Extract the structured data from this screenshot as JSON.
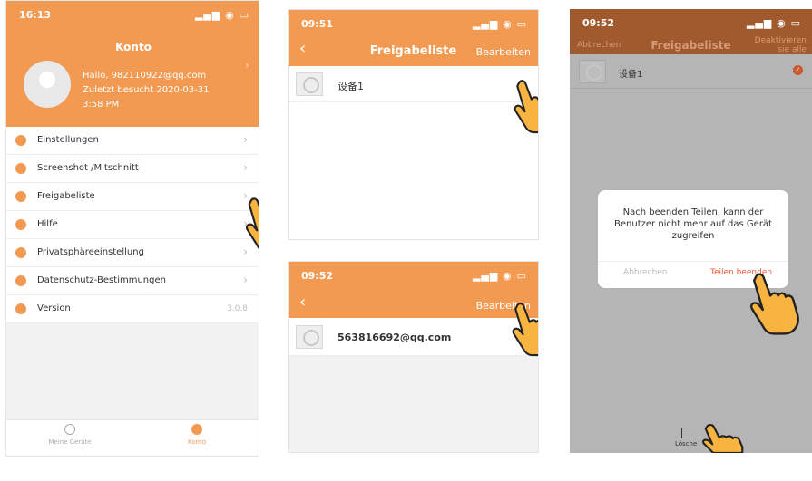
{
  "screen1": {
    "time": "16:13",
    "title": "Konto",
    "greeting": "Hallo, 982110922@qq.com",
    "last_visit": "Zuletzt besucht 2020-03-31",
    "last_visit_time": "3:58 PM",
    "menu": [
      {
        "label": "Einstellungen",
        "icon": "settings-icon"
      },
      {
        "label": "Screenshot /Mitschnitt",
        "icon": "camera-icon"
      },
      {
        "label": "Freigabeliste",
        "icon": "share-icon"
      },
      {
        "label": "Hilfe",
        "icon": "help-icon"
      },
      {
        "label": "Privatsphäreeinstellung",
        "icon": "privacy-icon"
      },
      {
        "label": "Datenschutz-Bestimmungen",
        "icon": "policy-icon"
      },
      {
        "label": "Version",
        "icon": "info-icon",
        "value": "3.0.8"
      }
    ],
    "tabs": [
      {
        "label": "Meine Geräte",
        "icon": "device-icon"
      },
      {
        "label": "Konto",
        "icon": "user-icon"
      }
    ]
  },
  "screen2": {
    "time": "09:51",
    "title": "Freigabeliste",
    "action": "Bearbeiten",
    "device": "设备1"
  },
  "screen3": {
    "time": "09:52",
    "action": "Bearbeiten",
    "email": "563816692@qq.com"
  },
  "screen4": {
    "time": "09:52",
    "left_action": "Abbrechen",
    "title": "Freigabeliste",
    "right_action_1": "Deaktivieren",
    "right_action_2": "sie alle",
    "device": "设备1",
    "dialog_message": "Nach beenden Teilen, kann der Benutzer nicht mehr auf das Gerät zugreifen",
    "dialog_cancel": "Abbrechen",
    "dialog_confirm": "Teilen beenden",
    "bottom_label": "Lösche"
  },
  "colors": {
    "accent": "#f39a52",
    "dark_accent": "#a15a2e",
    "danger": "#f05a3c"
  }
}
